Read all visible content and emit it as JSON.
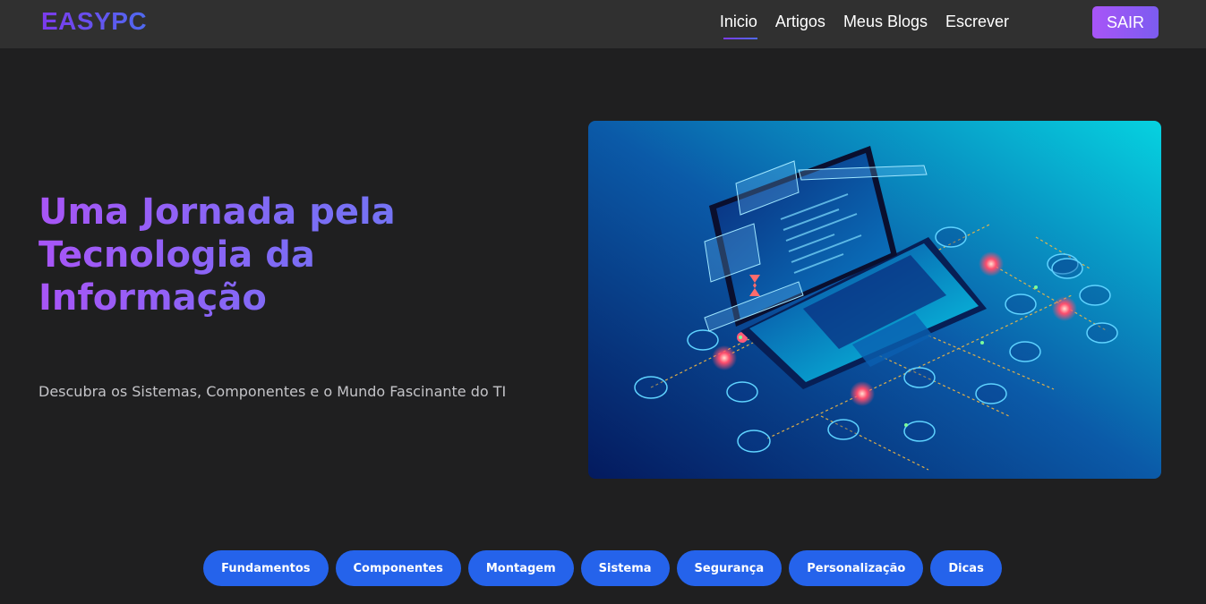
{
  "header": {
    "logo": "EASYPC",
    "nav": [
      {
        "label": "Inicio",
        "active": true
      },
      {
        "label": "Artigos"
      },
      {
        "label": "Meus Blogs"
      },
      {
        "label": "Escrever"
      }
    ],
    "logout_label": "SAIR"
  },
  "hero": {
    "title": "Uma Jornada pela Tecnologia da Informação",
    "subtitle": "Descubra os Sistemas, Componentes e o Mundo Fascinante do TI"
  },
  "categories": [
    "Fundamentos",
    "Componentes",
    "Montagem",
    "Sistema",
    "Segurança",
    "Personalização",
    "Dicas"
  ],
  "colors": {
    "background": "#1f1f20",
    "navbar": "#303030",
    "accent_purple": "#a855f7",
    "accent_blue": "#2563eb"
  }
}
